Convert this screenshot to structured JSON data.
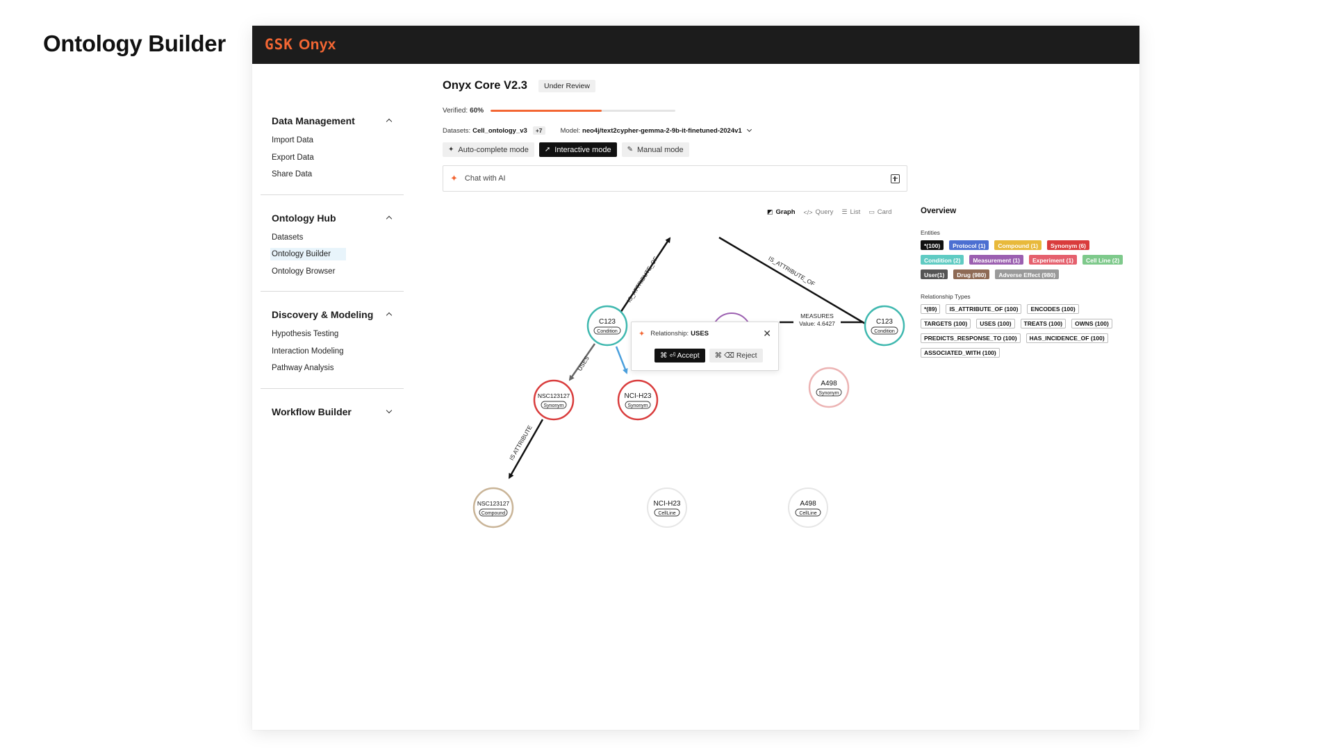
{
  "page": {
    "heading": "Ontology Builder"
  },
  "brand": {
    "gsk": "GSK",
    "name": "Onyx",
    "color": "#f36633"
  },
  "sidebar": {
    "sections": [
      {
        "title": "Data Management",
        "expanded": true,
        "items": [
          "Import Data",
          "Export Data",
          "Share Data"
        ]
      },
      {
        "title": "Ontology Hub",
        "expanded": true,
        "items": [
          "Datasets",
          "Ontology Builder",
          "Ontology Browser"
        ],
        "active_item": "Ontology Builder"
      },
      {
        "title": "Discovery & Modeling",
        "expanded": true,
        "items": [
          "Hypothesis Testing",
          "Interaction Modeling",
          "Pathway Analysis"
        ]
      },
      {
        "title": "Workflow Builder",
        "expanded": false,
        "items": []
      }
    ]
  },
  "project": {
    "title": "Onyx Core V2.3",
    "status": "Under Review",
    "verified_label": "Verified:",
    "verified_value": "60%",
    "verified_fraction": 0.6,
    "datasets_label": "Datasets:",
    "datasets_value": "Cell_ontology_v3",
    "datasets_more": "+7",
    "model_label": "Model:",
    "model_value": "neo4j/text2cypher-gemma-2-9b-it-finetuned-2024v1"
  },
  "modes": [
    {
      "label": "Auto-complete mode",
      "icon": "sparkle-icon",
      "active": false
    },
    {
      "label": "Interactive mode",
      "icon": "cursor-icon",
      "active": true
    },
    {
      "label": "Manual mode",
      "icon": "edit-icon",
      "active": false
    }
  ],
  "chat": {
    "label": "Chat with AI"
  },
  "view_tabs": [
    {
      "label": "Graph",
      "icon": "graph-icon",
      "active": true
    },
    {
      "label": "Query",
      "icon": "code-icon",
      "active": false
    },
    {
      "label": "List",
      "icon": "list-icon",
      "active": false
    },
    {
      "label": "Card",
      "icon": "card-icon",
      "active": false
    }
  ],
  "graph": {
    "nodes": [
      {
        "id": "c123a",
        "title": "C123",
        "type": "Condition",
        "color": "#3fb8af",
        "faded": false
      },
      {
        "id": "c123b",
        "title": "C123",
        "type": "Condition",
        "color": "#3fb8af",
        "faded": false
      },
      {
        "id": "nsc_syn",
        "title": "NSC123127",
        "type": "Synonym",
        "color": "#d93c3c",
        "faded": false
      },
      {
        "id": "nci_syn",
        "title": "NCI-H23",
        "type": "Synonym",
        "color": "#d93c3c",
        "faded": false
      },
      {
        "id": "a498_syn",
        "title": "A498",
        "type": "Synonym",
        "color": "#ecb3b3",
        "faded": true
      },
      {
        "id": "nsc_cmp",
        "title": "NSC123127",
        "type": "Compound",
        "color": "#c9b497",
        "faded": false
      },
      {
        "id": "nci_cell",
        "title": "NCI-H23",
        "type": "CellLine",
        "color": "#e6e6e6",
        "faded": true
      },
      {
        "id": "a498_cell",
        "title": "A498",
        "type": "CellLine",
        "color": "#e6e6e6",
        "faded": true
      }
    ],
    "edge_labels": {
      "is_attribute_of_1": "IS_ATTRIBUTE_OF",
      "is_attribute_of_2": "IS_ATTRIBUTE_OF",
      "uses": "USES",
      "is_attribute": "IS ATTRIBUTE",
      "measures": "MEASURES",
      "measures_value": "Value: 4.6427"
    },
    "suggestion": {
      "label": "Relationship:",
      "value": "USES",
      "accept": "⌘ ⏎ Accept",
      "reject": "⌘ ⌫ Reject"
    }
  },
  "overview": {
    "title": "Overview",
    "entities_label": "Entities",
    "entities": [
      {
        "label": "*(100)",
        "color": "#111111"
      },
      {
        "label": "Protocol (1)",
        "color": "#4c6fd1"
      },
      {
        "label": "Compound (1)",
        "color": "#e8b93b"
      },
      {
        "label": "Synonym (6)",
        "color": "#d93c3c"
      },
      {
        "label": "Condition (2)",
        "color": "#5fcbc3"
      },
      {
        "label": "Measurement (1)",
        "color": "#9b5fb0"
      },
      {
        "label": "Experiment (1)",
        "color": "#e5606d"
      },
      {
        "label": "Cell Line (2)",
        "color": "#7ec98b"
      },
      {
        "label": "User(1)",
        "color": "#555555"
      },
      {
        "label": "Drug (980)",
        "color": "#8e6a55"
      },
      {
        "label": "Adverse Effect (980)",
        "color": "#9a9a9a"
      }
    ],
    "relationships_label": "Relationship Types",
    "relationships": [
      "*(89)",
      "IS_ATTRIBUTE_OF (100)",
      "ENCODES (100)",
      "TARGETS (100)",
      "USES (100)",
      "TREATS (100)",
      "OWNS (100)",
      "PREDICTS_RESPONSE_TO (100)",
      "HAS_INCIDENCE_OF (100)",
      "ASSOCIATED_WITH (100)"
    ]
  }
}
